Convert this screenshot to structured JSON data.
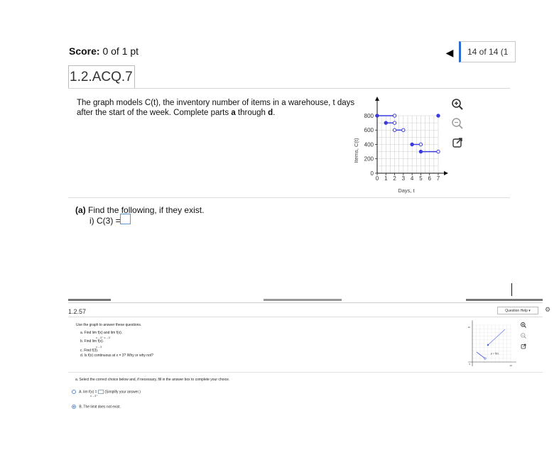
{
  "header": {
    "score_label": "Score:",
    "score_value": "0 of 1 pt",
    "question_counter": "14 of 14 (1",
    "question_id": "1.2.ACQ.7"
  },
  "question": {
    "prompt_line1": "The graph models C(t), the inventory number of items in a warehouse, t days",
    "prompt_line2_pre": "after the start of the week. Complete parts ",
    "prompt_a": "a",
    "prompt_mid": " through ",
    "prompt_d": "d",
    "prompt_end": "."
  },
  "chart_data": {
    "type": "line",
    "xlabel": "Days, t",
    "ylabel": "Items, C(t)",
    "x_ticks": [
      "0",
      "1",
      "2",
      "3",
      "4",
      "5",
      "6",
      "7"
    ],
    "y_ticks": [
      "0",
      "200",
      "400",
      "600",
      "800"
    ],
    "xlim": [
      0,
      7
    ],
    "ylim": [
      0,
      800
    ],
    "grid": true,
    "segments": [
      {
        "x": [
          0,
          2
        ],
        "y": [
          800,
          800
        ],
        "start": "closed",
        "end": "open"
      },
      {
        "x": [
          1,
          2
        ],
        "y": [
          700,
          700
        ],
        "start": "closed",
        "end": "open"
      },
      {
        "x": [
          2,
          3
        ],
        "y": [
          600,
          600
        ],
        "start": "open",
        "end": "open"
      },
      {
        "x": [
          4,
          5
        ],
        "y": [
          400,
          400
        ],
        "start": "closed",
        "end": "open"
      },
      {
        "x": [
          5,
          7
        ],
        "y": [
          300,
          300
        ],
        "start": "closed",
        "end": "open"
      }
    ],
    "points": [
      {
        "x": 7,
        "y": 800,
        "type": "closed"
      }
    ],
    "color": "#3a3adf"
  },
  "tools": [
    "zoom-in-icon",
    "zoom-out-icon",
    "popout-icon"
  ],
  "part_a": {
    "label": "(a)",
    "text": " Find the following, if they exist.",
    "item": "i) C(3) ="
  },
  "second": {
    "question_id": "1.2.57",
    "help_label": "Question Help ▾",
    "intro": "Use the graph to answer these questions.",
    "a": "a. Find  lim  f(x) and  lim  f(x).",
    "a_sub": "x→3⁺                    x→3⁻",
    "b": "b. Find  lim f(x).",
    "b_sub": "x→3",
    "c": "c. Find f(3).",
    "d": "d. Is f(x) continuous at x = 3? Why or why not?",
    "instruction": "a. Select the correct choice below and, if necessary, fill in the answer box to complete your choice.",
    "option_a_pre": "A.  lim  f(x) =",
    "option_a_post": "(Simplify your answer.)",
    "option_a_sub": "x→3⁺",
    "option_b": "B.  The limit does not exist.",
    "graph_label": "y = f(x)",
    "graph_ytop": "10",
    "graph_xend": "10",
    "graph_origin": "0"
  }
}
